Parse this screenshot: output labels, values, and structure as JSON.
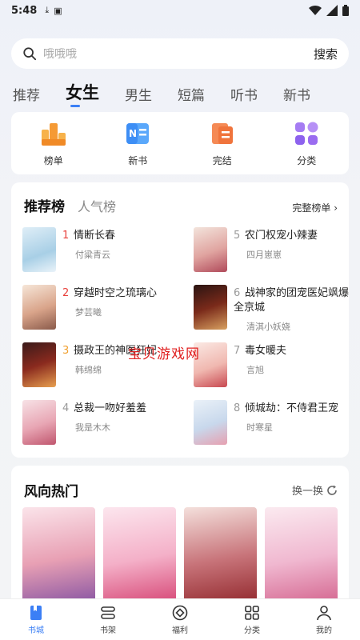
{
  "status_bar": {
    "time": "5:48"
  },
  "search": {
    "placeholder": "哦哦哦",
    "button": "搜索"
  },
  "tabs": [
    "推荐",
    "女生",
    "男生",
    "短篇",
    "听书",
    "新书"
  ],
  "quick_entries": [
    {
      "label": "榜单",
      "icon": "ranking-list-icon",
      "color": "#f59a35"
    },
    {
      "label": "新书",
      "icon": "new-book-icon",
      "color": "#3d8ef5"
    },
    {
      "label": "完结",
      "icon": "finished-icon",
      "color": "#f0743c"
    },
    {
      "label": "分类",
      "icon": "category-icon",
      "color": "#9a6cf0"
    }
  ],
  "ranking": {
    "title": "推荐榜",
    "alt_tab": "人气榜",
    "more": "完整榜单",
    "books": [
      {
        "rank": "1",
        "title": "情断长春",
        "author": "付粱青云"
      },
      {
        "rank": "2",
        "title": "穿越时空之琉璃心",
        "author": "梦芸曦"
      },
      {
        "rank": "3",
        "title": "摄政王的神医狂妃",
        "author": "韩绵绵"
      },
      {
        "rank": "4",
        "title": "总裁一吻好羞羞",
        "author": "我是木木"
      },
      {
        "rank": "5",
        "title": "农门权宠小辣妻",
        "author": "四月崽崽"
      },
      {
        "rank": "6",
        "title": "战神家的团宠医妃飒爆全京城",
        "author": "清淇小妖娆"
      },
      {
        "rank": "7",
        "title": "毒女暖夫",
        "author": "言旭"
      },
      {
        "rank": "8",
        "title": "倾城劫：不侍君王宠",
        "author": "时寒星"
      }
    ]
  },
  "trending": {
    "title": "风向热门",
    "refresh": "换一换"
  },
  "watermark": "宝贝游戏网",
  "bottom_nav": [
    {
      "label": "书城",
      "icon": "bookstore-icon",
      "active": true
    },
    {
      "label": "书架",
      "icon": "bookshelf-icon",
      "active": false
    },
    {
      "label": "福利",
      "icon": "welfare-icon",
      "active": false
    },
    {
      "label": "分类",
      "icon": "category-grid-icon",
      "active": false
    },
    {
      "label": "我的",
      "icon": "profile-icon",
      "active": false
    }
  ],
  "colors": {
    "accent": "#3b7ff5",
    "rank_top": "#e8413c",
    "rank_normal": "#999999"
  }
}
